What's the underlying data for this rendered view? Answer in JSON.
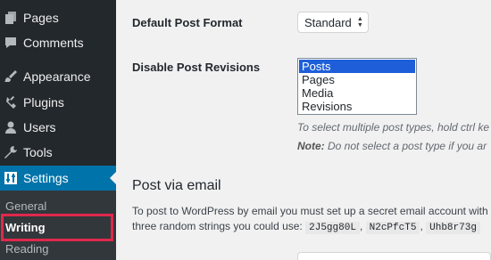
{
  "sidebar": {
    "items": [
      {
        "label": "Pages",
        "icon": "pages-icon"
      },
      {
        "label": "Comments",
        "icon": "comments-icon"
      },
      {
        "label": "Appearance",
        "icon": "appearance-icon"
      },
      {
        "label": "Plugins",
        "icon": "plugins-icon"
      },
      {
        "label": "Users",
        "icon": "users-icon"
      },
      {
        "label": "Tools",
        "icon": "tools-icon"
      },
      {
        "label": "Settings",
        "icon": "settings-icon",
        "active": true
      }
    ],
    "submenu": [
      {
        "label": "General"
      },
      {
        "label": "Writing",
        "current": true
      },
      {
        "label": "Reading"
      }
    ]
  },
  "main": {
    "default_post_format": {
      "label": "Default Post Format",
      "value": "Standard"
    },
    "disable_revisions": {
      "label": "Disable Post Revisions",
      "options": [
        "Posts",
        "Pages",
        "Media",
        "Revisions"
      ],
      "selected": "Posts",
      "hint": "To select multiple post types, hold ctrl ke",
      "note_label": "Note:",
      "note_text": " Do not select a post type if you ar"
    },
    "post_via_email": {
      "title": "Post via email",
      "text_line1": "To post to WordPress by email you must set up a secret email account with POP",
      "text_line2": "three random strings you could use:",
      "sep": ",",
      "codes": [
        "2J5gg80L",
        "N2cPfcT5",
        "Uhb8r73g"
      ]
    }
  },
  "colors": {
    "sidebar_bg": "#23282d",
    "submenu_bg": "#32373c",
    "active_bg": "#0073aa",
    "highlight": "#e0294b",
    "list_selected": "#1e5fd9"
  }
}
